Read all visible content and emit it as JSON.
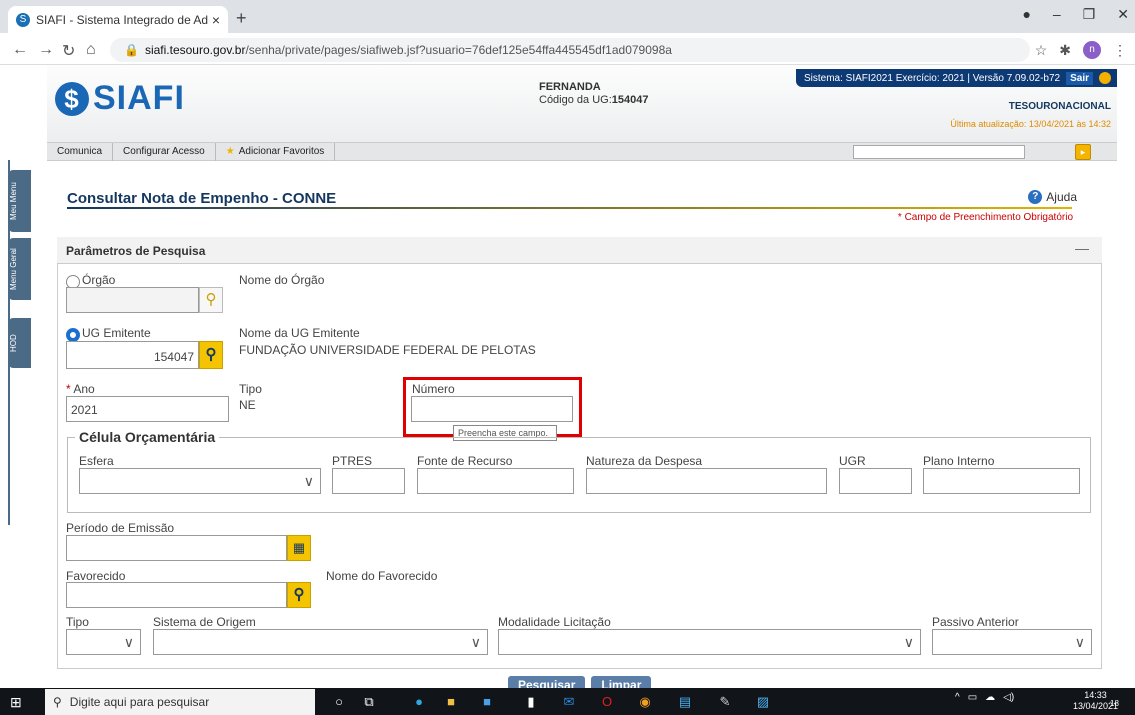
{
  "browser": {
    "tab_title": "SIAFI - Sistema Integrado de Adm",
    "url_domain": "siafi.tesouro.gov.br",
    "url_path": "/senha/private/pages/siafiweb.jsf?usuario=76def125e54ffa445545df1ad079098a",
    "profile_initial": "n"
  },
  "header": {
    "logo_text": "SIAFI",
    "user_name": "FERNANDA",
    "ug_label": "Código da UG:",
    "ug_code": "154047",
    "system_info": "Sistema: SIAFI2021 Exercício: 2021 | Versão 7.09.02-b72",
    "exit_label": "Sair",
    "tesouro": "TESOURONACIONAL",
    "last_update": "Última atualização: 13/04/2021 às 14:32"
  },
  "menubar": {
    "items": [
      "Comunica",
      "Configurar Acesso",
      "Adicionar Favoritos"
    ]
  },
  "sidetabs": [
    "Meu Menu",
    "Menu Geral",
    "HOD"
  ],
  "page": {
    "title": "Consultar Nota de Empenho - CONNE",
    "help": "Ajuda",
    "required_note": "* Campo de Preenchimento Obrigatório"
  },
  "panel": {
    "title": "Parâmetros de Pesquisa",
    "orgao_label": "Órgão",
    "orgao_name_label": "Nome do Órgão",
    "ug_label": "UG Emitente",
    "ug_value": "154047",
    "ug_name_label": "Nome da UG Emitente",
    "ug_name_value": "FUNDAÇÃO UNIVERSIDADE FEDERAL DE PELOTAS",
    "ano_star": "*",
    "ano_label": "Ano",
    "ano_value": "2021",
    "tipo_label": "Tipo",
    "tipo_value": "NE",
    "numero_label": "Número",
    "numero_tooltip": "Preencha este campo.",
    "celula_title": "Célula Orçamentária",
    "esfera_label": "Esfera",
    "ptres_label": "PTRES",
    "fonte_label": "Fonte de Recurso",
    "natureza_label": "Natureza da Despesa",
    "ugr_label": "UGR",
    "plano_label": "Plano Interno",
    "periodo_label": "Período de Emissão",
    "favorecido_label": "Favorecido",
    "nome_favorecido_label": "Nome do Favorecido",
    "tipo2_label": "Tipo",
    "sistema_label": "Sistema de Origem",
    "modalidade_label": "Modalidade Licitação",
    "passivo_label": "Passivo Anterior"
  },
  "buttons": {
    "search": "Pesquisar",
    "clear": "Limpar"
  },
  "taskbar": {
    "search_placeholder": "Digite aqui para pesquisar",
    "time": "14:33",
    "date": "13/04/2021",
    "notif_count": "18"
  }
}
